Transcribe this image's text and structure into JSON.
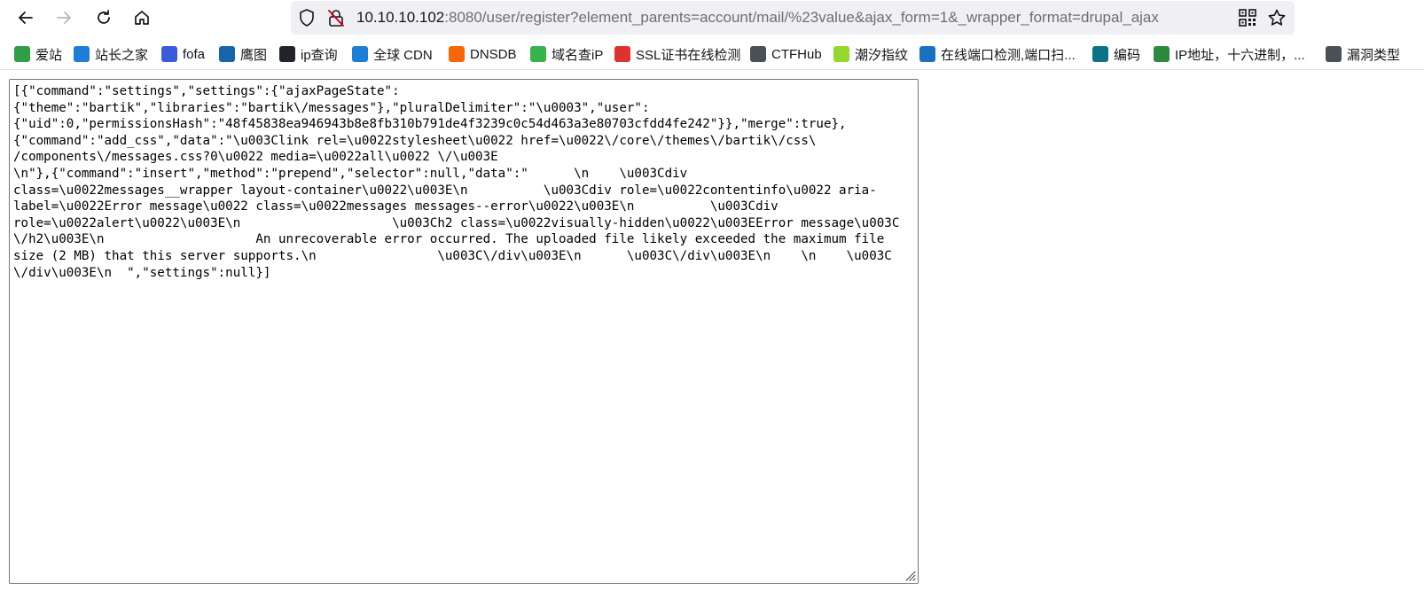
{
  "browser": {
    "url_host": "10.10.10.102",
    "url_rest": ":8080/user/register?element_parents=account/mail/%23value&ajax_form=1&_wrapper_format=drupal_ajax"
  },
  "icons": {
    "back": "arrow-left-icon",
    "forward": "arrow-right-icon",
    "reload": "reload-icon",
    "home": "home-icon",
    "tracking": "shield-icon",
    "insecure": "insecure-lock-icon",
    "qr": "qr-code-icon",
    "bookmark": "star-icon"
  },
  "bookmarks": [
    {
      "label": "爱站",
      "color": "#2f9e44"
    },
    {
      "label": "站长之家",
      "color": "#1c7ed6"
    },
    {
      "label": "fofa",
      "color": "#3b5bdb"
    },
    {
      "label": "鹰图",
      "color": "#1864ab"
    },
    {
      "label": "ip查询",
      "color": "#212529"
    },
    {
      "label": "全球 CDN",
      "color": "#1c7ed6"
    },
    {
      "label": "DNSDB",
      "color": "#f76707"
    },
    {
      "label": "域名查iP",
      "color": "#37b24d"
    },
    {
      "label": "SSL证书在线检测",
      "color": "#e03131"
    },
    {
      "label": "CTFHub",
      "color": "#495057"
    },
    {
      "label": "潮汐指纹",
      "color": "#94d82d"
    },
    {
      "label": "在线端口检测,端口扫...",
      "color": "#1971c2"
    },
    {
      "label": "编码",
      "color": "#0b7285"
    },
    {
      "label": "IP地址，十六进制，...",
      "color": "#2b8a3e"
    },
    {
      "label": "漏洞类型",
      "color": "#495057"
    }
  ],
  "response": {
    "body": "[{\"command\":\"settings\",\"settings\":{\"ajaxPageState\":\n{\"theme\":\"bartik\",\"libraries\":\"bartik\\/messages\"},\"pluralDelimiter\":\"\\u0003\",\"user\":\n{\"uid\":0,\"permissionsHash\":\"48f45838ea946943b8e8fb310b791de4f3239c0c54d463a3e80703cfdd4fe242\"}},\"merge\":true},\n{\"command\":\"add_css\",\"data\":\"\\u003Clink rel=\\u0022stylesheet\\u0022 href=\\u0022\\/core\\/themes\\/bartik\\/css\\\n/components\\/messages.css?0\\u0022 media=\\u0022all\\u0022 \\/\\u003E\n\\n\"},{\"command\":\"insert\",\"method\":\"prepend\",\"selector\":null,\"data\":\"      \\n    \\u003Cdiv\nclass=\\u0022messages__wrapper layout-container\\u0022\\u003E\\n          \\u003Cdiv role=\\u0022contentinfo\\u0022 aria-\nlabel=\\u0022Error message\\u0022 class=\\u0022messages messages--error\\u0022\\u003E\\n          \\u003Cdiv\nrole=\\u0022alert\\u0022\\u003E\\n                    \\u003Ch2 class=\\u0022visually-hidden\\u0022\\u003EError message\\u003C\n\\/h2\\u003E\\n                    An unrecoverable error occurred. The uploaded file likely exceeded the maximum file\nsize (2 MB) that this server supports.\\n                \\u003C\\/div\\u003E\\n      \\u003C\\/div\\u003E\\n    \\n    \\u003C\n\\/div\\u003E\\n  \",\"settings\":null}]"
  }
}
